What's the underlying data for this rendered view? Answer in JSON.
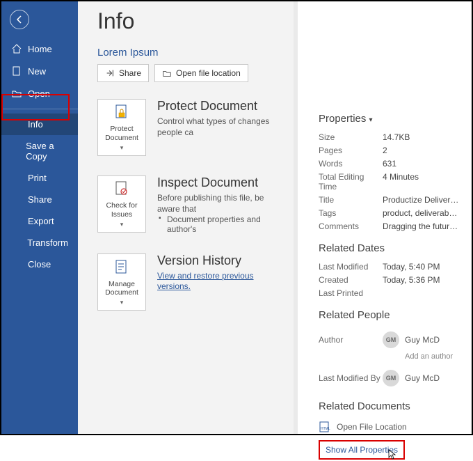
{
  "sidebar": {
    "items": [
      {
        "label": "Home"
      },
      {
        "label": "New"
      },
      {
        "label": "Open"
      },
      {
        "label": "Info"
      },
      {
        "label": "Save a Copy"
      },
      {
        "label": "Print"
      },
      {
        "label": "Share"
      },
      {
        "label": "Export"
      },
      {
        "label": "Transform"
      },
      {
        "label": "Close"
      }
    ]
  },
  "page": {
    "title": "Info",
    "docname": "Lorem Ipsum",
    "share": "Share",
    "openloc": "Open file location"
  },
  "protect": {
    "title": "Protect Document",
    "desc": "Control what types of changes people ca",
    "card": "Protect Document"
  },
  "inspect": {
    "title": "Inspect Document",
    "desc": "Before publishing this file, be aware that",
    "bullet": "Document properties and author's",
    "card": "Check for Issues"
  },
  "version": {
    "title": "Version History",
    "link": "View and restore previous versions.",
    "card": "Manage Document"
  },
  "props": {
    "header": "Properties",
    "rows": {
      "size_k": "Size",
      "size_v": "14.7KB",
      "pages_k": "Pages",
      "pages_v": "2",
      "words_k": "Words",
      "words_v": "631",
      "time_k": "Total Editing Time",
      "time_v": "4 Minutes",
      "title_k": "Title",
      "title_v": "Productize Deliverables",
      "tags_k": "Tags",
      "tags_v": "product, deliverables, opti...",
      "comments_k": "Comments",
      "comments_v": "Dragging the future into n..."
    }
  },
  "dates": {
    "header": "Related Dates",
    "modified_k": "Last Modified",
    "modified_v": "Today, 5:40 PM",
    "created_k": "Created",
    "created_v": "Today, 5:36 PM",
    "printed_k": "Last Printed",
    "printed_v": ""
  },
  "people": {
    "header": "Related People",
    "author_k": "Author",
    "author_name": "Guy McD",
    "author_initials": "GM",
    "add_author": "Add an author",
    "modifiedby_k": "Last Modified By",
    "modifiedby_name": "Guy McD",
    "modifiedby_initials": "GM"
  },
  "docs": {
    "header": "Related Documents",
    "openloc": "Open File Location",
    "show_all": "Show All Properties"
  }
}
